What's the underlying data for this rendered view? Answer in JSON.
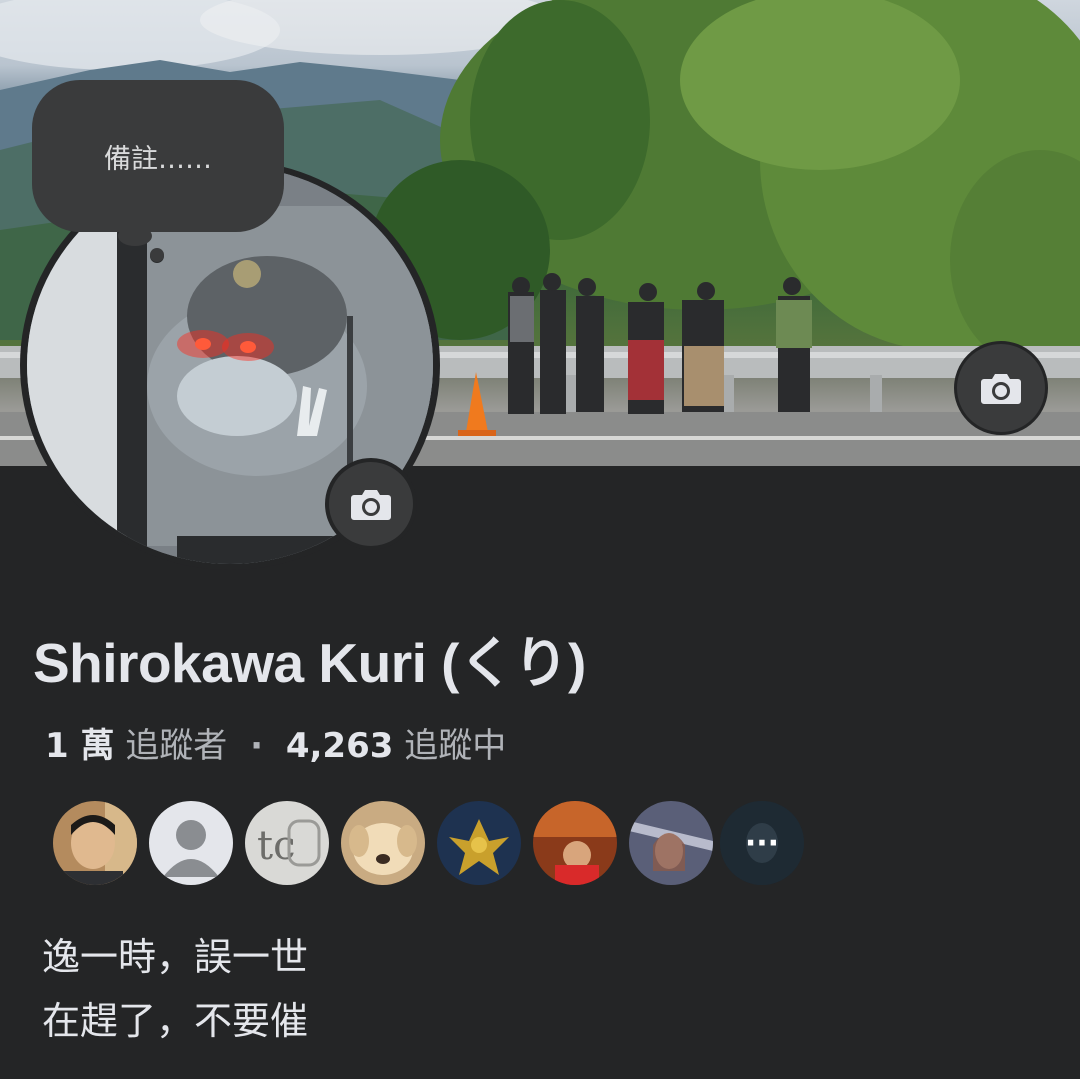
{
  "note": {
    "text": "備註……"
  },
  "profile": {
    "name": "Shirokawa Kuri (くり)",
    "followers_count": "1 萬",
    "followers_label": "追蹤者",
    "separator": "·",
    "following_count": "4,263",
    "following_label": "追蹤中"
  },
  "friend_avatars": [
    {
      "name": "friend-avatar-1"
    },
    {
      "name": "friend-avatar-2-default"
    },
    {
      "name": "friend-avatar-3"
    },
    {
      "name": "friend-avatar-4"
    },
    {
      "name": "friend-avatar-5"
    },
    {
      "name": "friend-avatar-6"
    },
    {
      "name": "friend-avatar-7"
    }
  ],
  "more_friends": {
    "icon": "more-dots-icon",
    "text": "···"
  },
  "bio": {
    "line1": "逸一時，誤一世",
    "line2": "在趕了，不要催"
  },
  "icons": {
    "cover_camera": "camera-icon",
    "avatar_camera": "camera-icon"
  },
  "colors": {
    "background": "#242526",
    "button_bg": "#3a3b3c",
    "text_primary": "#e4e6eb",
    "text_secondary": "#b0b3b8",
    "eye_glow": "#ff2a1a"
  }
}
